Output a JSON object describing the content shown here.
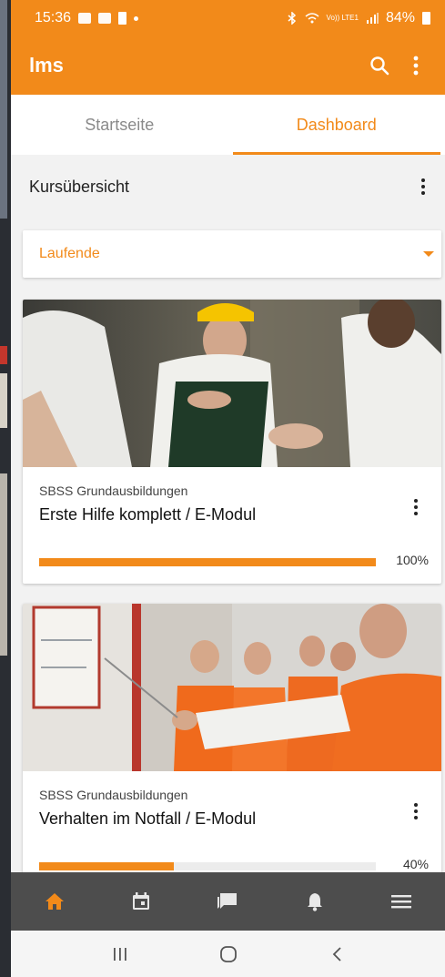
{
  "status_bar": {
    "time": "15:36",
    "battery": "84%",
    "signal_label": "Vo)) LTE1"
  },
  "app_bar": {
    "title": "lms",
    "search_icon": "search-icon",
    "menu_icon": "more-vert-icon"
  },
  "tabs": [
    {
      "label": "Startseite",
      "active": false
    },
    {
      "label": "Dashboard",
      "active": true
    }
  ],
  "section": {
    "title": "Kursübersicht"
  },
  "filter": {
    "selected": "Laufende",
    "options_icon": "caret-down-icon"
  },
  "courses": [
    {
      "category": "SBSS Grundausbildungen",
      "title": "Erste Hilfe komplett / E-Modul",
      "progress": 1.0,
      "progress_label": "100%"
    },
    {
      "category": "SBSS Grundausbildungen",
      "title": "Verhalten im Notfall / E-Modul",
      "progress": 0.4,
      "progress_label": "40%"
    }
  ],
  "bottom_nav": [
    {
      "icon": "home-icon",
      "active": true
    },
    {
      "icon": "calendar-icon",
      "active": false
    },
    {
      "icon": "chat-icon",
      "active": false
    },
    {
      "icon": "bell-icon",
      "active": false
    },
    {
      "icon": "menu-icon",
      "active": false
    }
  ],
  "system_nav": [
    "recents-icon",
    "home-circle-icon",
    "back-icon"
  ],
  "colors": {
    "accent": "#f28a1a",
    "nav_bg": "#4d4d4d"
  }
}
